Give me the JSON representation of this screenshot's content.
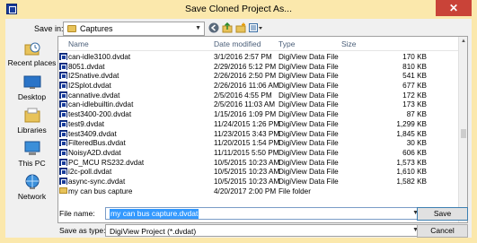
{
  "window": {
    "title": "Save Cloned Project As...",
    "close_glyph": "✕"
  },
  "toolbar": {
    "save_in_label": "Save in:",
    "save_in_value": "Captures",
    "back_icon": "back-arrow-icon",
    "up_icon": "up-folder-icon",
    "new_folder_icon": "new-folder-icon",
    "views_icon": "view-menu-icon"
  },
  "places": [
    {
      "label": "Recent places",
      "icon": "recent-places-icon"
    },
    {
      "label": "Desktop",
      "icon": "desktop-icon"
    },
    {
      "label": "Libraries",
      "icon": "libraries-icon"
    },
    {
      "label": "This PC",
      "icon": "this-pc-icon"
    },
    {
      "label": "Network",
      "icon": "network-icon"
    }
  ],
  "columns": {
    "name": "Name",
    "date": "Date modified",
    "type": "Type",
    "size": "Size"
  },
  "files": [
    {
      "name": "can-idle3100.dvdat",
      "date": "3/1/2016 2:57 PM",
      "type": "DigiView Data File",
      "size": "170 KB"
    },
    {
      "name": "8051.dvdat",
      "date": "2/29/2016 5:12 PM",
      "type": "DigiView Data File",
      "size": "810 KB"
    },
    {
      "name": "I2Snative.dvdat",
      "date": "2/26/2016 2:50 PM",
      "type": "DigiView Data File",
      "size": "541 KB"
    },
    {
      "name": "I2Splot.dvdat",
      "date": "2/26/2016 11:06 AM",
      "type": "DigiView Data File",
      "size": "677 KB"
    },
    {
      "name": "cannative.dvdat",
      "date": "2/5/2016 4:55 PM",
      "type": "DigiView Data File",
      "size": "172 KB"
    },
    {
      "name": "can-idlebuiltin.dvdat",
      "date": "2/5/2016 11:03 AM",
      "type": "DigiView Data File",
      "size": "173 KB"
    },
    {
      "name": "test3400-200.dvdat",
      "date": "1/15/2016 1:09 PM",
      "type": "DigiView Data File",
      "size": "87 KB"
    },
    {
      "name": "test9.dvdat",
      "date": "11/24/2015 1:26 PM",
      "type": "DigiView Data File",
      "size": "1,299 KB"
    },
    {
      "name": "test3409.dvdat",
      "date": "11/23/2015 3:43 PM",
      "type": "DigiView Data File",
      "size": "1,845 KB"
    },
    {
      "name": "FilteredBus.dvdat",
      "date": "11/20/2015 1:54 PM",
      "type": "DigiView Data File",
      "size": "30 KB"
    },
    {
      "name": "NoisyA2D.dvdat",
      "date": "11/11/2015 5:50 PM",
      "type": "DigiView Data File",
      "size": "606 KB"
    },
    {
      "name": "PC_MCU RS232.dvdat",
      "date": "10/5/2015 10:23 AM",
      "type": "DigiView Data File",
      "size": "1,573 KB"
    },
    {
      "name": "i2c-poll.dvdat",
      "date": "10/5/2015 10:23 AM",
      "type": "DigiView Data File",
      "size": "1,610 KB"
    },
    {
      "name": "async-sync.dvdat",
      "date": "10/5/2015 10:23 AM",
      "type": "DigiView Data File",
      "size": "1,582 KB"
    },
    {
      "name": "my can bus capture",
      "date": "4/20/2017 2:00 PM",
      "type": "File folder",
      "size": ""
    }
  ],
  "form": {
    "file_name_label": "File name:",
    "file_name_value": "my can bus capture.dvdat",
    "save_as_type_label": "Save as type:",
    "save_as_type_value": "DigiView Project (*.dvdat)"
  },
  "buttons": {
    "save": "Save",
    "cancel": "Cancel"
  },
  "colors": {
    "title_bg": "#fbe8ac",
    "close_bg": "#c94338",
    "selection": "#3399ff"
  }
}
